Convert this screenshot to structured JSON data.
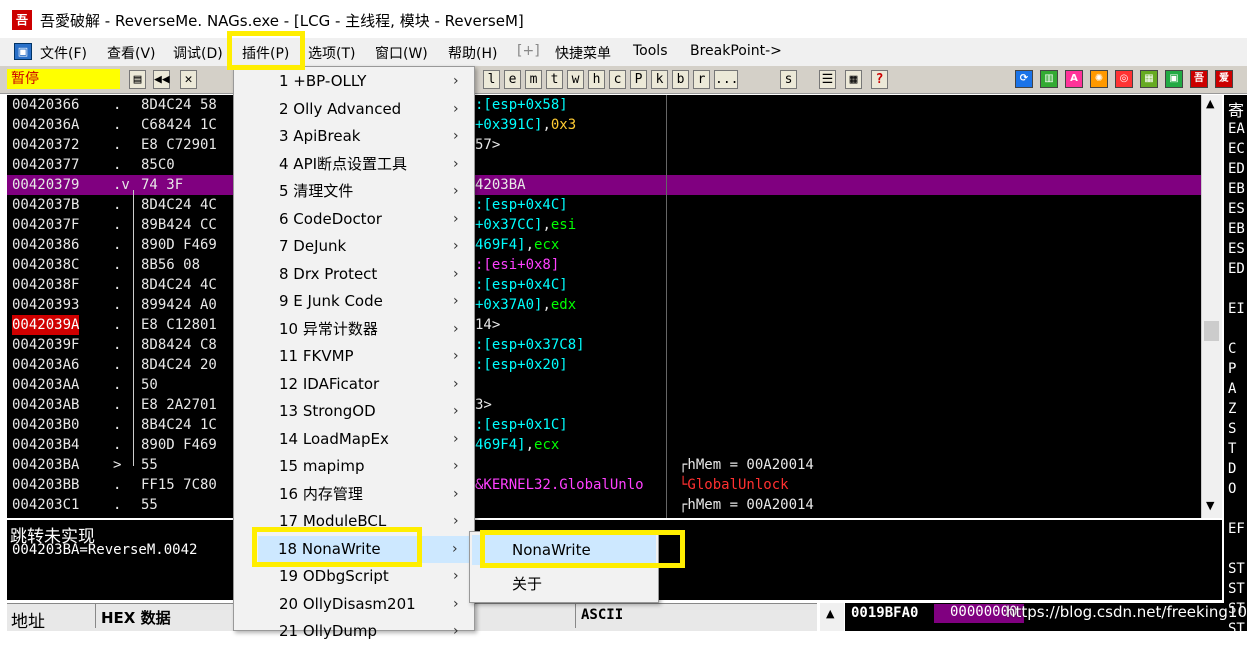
{
  "window": {
    "title": "吾愛破解 - ReverseMe. NAGs.exe - [LCG -  主线程, 模块 - ReverseM]",
    "icon": "吾"
  },
  "menubar": {
    "items": [
      "文件(F)",
      "查看(V)",
      "调试(D)",
      "插件(P)",
      "选项(T)",
      "窗口(W)",
      "帮助(H)",
      "[+]",
      "快捷菜单",
      "Tools",
      "BreakPoint->"
    ]
  },
  "toolbar": {
    "status": "暂停",
    "letters": [
      "l",
      "e",
      "m",
      "t",
      "w",
      "h",
      "c",
      "P",
      "k",
      "b",
      "r",
      "...",
      "s"
    ],
    "right_icons": [
      "吾",
      "爱"
    ]
  },
  "disasm": {
    "rows": [
      {
        "addr": "00420366",
        "mark": ".",
        "hex": "8D4C24 58",
        "asm": [
          [
            "c",
            ":[esp+0x58]"
          ]
        ],
        "cmt": ""
      },
      {
        "addr": "0042036A",
        "mark": ".",
        "hex": "C68424 1C",
        "asm": [
          [
            "c",
            "+0x391C]"
          ],
          [
            "w",
            ","
          ],
          [
            "y",
            "0x3"
          ]
        ],
        "cmt": ""
      },
      {
        "addr": "00420372",
        "mark": ".",
        "hex": "E8 C72901",
        "asm": [
          [
            "w",
            "57>"
          ]
        ],
        "cmt": ""
      },
      {
        "addr": "00420377",
        "mark": ".",
        "hex": "85C0",
        "asm": [],
        "cmt": ""
      },
      {
        "addr": "00420379",
        "mark": ".v",
        "hex": "74 3F",
        "asm": [
          [
            "w",
            "4203BA"
          ]
        ],
        "cmt": "",
        "hl": true
      },
      {
        "addr": "0042037B",
        "mark": ".",
        "hex": "8D4C24 4C",
        "asm": [
          [
            "c",
            ":[esp+0x4C]"
          ]
        ],
        "cmt": ""
      },
      {
        "addr": "0042037F",
        "mark": ".",
        "hex": "89B424 CC",
        "asm": [
          [
            "c",
            "+0x37CC]"
          ],
          [
            "w",
            ","
          ],
          [
            "g",
            "esi"
          ]
        ],
        "cmt": ""
      },
      {
        "addr": "00420386",
        "mark": ".",
        "hex": "890D F469",
        "asm": [
          [
            "c",
            "469F4]"
          ],
          [
            "w",
            ","
          ],
          [
            "g",
            "ecx"
          ]
        ],
        "cmt": ""
      },
      {
        "addr": "0042038C",
        "mark": ".",
        "hex": "8B56 08",
        "asm": [
          [
            "m",
            ":[esi+0x8]"
          ]
        ],
        "cmt": ""
      },
      {
        "addr": "0042038F",
        "mark": ".",
        "hex": "8D4C24 4C",
        "asm": [
          [
            "c",
            ":[esp+0x4C]"
          ]
        ],
        "cmt": ""
      },
      {
        "addr": "00420393",
        "mark": ".",
        "hex": "899424 A0",
        "asm": [
          [
            "c",
            "+0x37A0]"
          ],
          [
            "w",
            ","
          ],
          [
            "g",
            "edx"
          ]
        ],
        "cmt": ""
      },
      {
        "addr": "0042039A",
        "mark": ".",
        "hex": "E8 C12801",
        "asm": [
          [
            "w",
            "14>"
          ]
        ],
        "cmt": "",
        "red": true
      },
      {
        "addr": "0042039F",
        "mark": ".",
        "hex": "8D8424 C8",
        "asm": [
          [
            "c",
            ":[esp+0x37C8]"
          ]
        ],
        "cmt": ""
      },
      {
        "addr": "004203A6",
        "mark": ".",
        "hex": "8D4C24 20",
        "asm": [
          [
            "c",
            ":[esp+0x20]"
          ]
        ],
        "cmt": ""
      },
      {
        "addr": "004203AA",
        "mark": ".",
        "hex": "50",
        "asm": [],
        "cmt": ""
      },
      {
        "addr": "004203AB",
        "mark": ".",
        "hex": "E8 2A2701",
        "asm": [
          [
            "w",
            "3>"
          ]
        ],
        "cmt": ""
      },
      {
        "addr": "004203B0",
        "mark": ".",
        "hex": "8B4C24 1C",
        "asm": [
          [
            "c",
            ":[esp+0x1C]"
          ]
        ],
        "cmt": ""
      },
      {
        "addr": "004203B4",
        "mark": ".",
        "hex": "890D F469",
        "asm": [
          [
            "c",
            "469F4]"
          ],
          [
            "w",
            ","
          ],
          [
            "g",
            "ecx"
          ]
        ],
        "cmt": ""
      },
      {
        "addr": "004203BA",
        "mark": ">",
        "hex": "55",
        "asm": [],
        "cmt": "┌hMem = 00A20014"
      },
      {
        "addr": "004203BB",
        "mark": ".",
        "hex": "FF15 7C80",
        "asm": [
          [
            "m",
            "&KERNEL32.GlobalUnlo"
          ]
        ],
        "cmt": "└GlobalUnlock",
        "cmtred": true
      },
      {
        "addr": "004203C1",
        "mark": ".",
        "hex": "55",
        "asm": [],
        "cmt": "┌hMem = 00A20014"
      }
    ]
  },
  "info": {
    "line1": "跳转未实现",
    "line2": "004203BA=ReverseM.0042"
  },
  "registers": {
    "header": "寄",
    "labels": [
      "EA",
      "EC",
      "ED",
      "EB",
      "ES",
      "EB",
      "ES",
      "ED",
      "",
      "EI",
      "",
      "C",
      "P",
      "A",
      "Z",
      "S",
      "T",
      "D",
      "O",
      "",
      "EF",
      "",
      "ST",
      "ST",
      "ST",
      "ST"
    ]
  },
  "dump": {
    "col_addr": "地址",
    "col_hex": "HEX 数据",
    "col_ascii": "ASCII"
  },
  "stack": {
    "addr": "0019BFA0",
    "value": "00000000"
  },
  "watermark": "https://blog.csdn.net/freeking101",
  "plugin_menu": {
    "items": [
      {
        "label": "1 +BP-OLLY"
      },
      {
        "label": "2 Olly Advanced"
      },
      {
        "label": "3 ApiBreak"
      },
      {
        "label": "4 API断点设置工具"
      },
      {
        "label": "5 清理文件"
      },
      {
        "label": "6 CodeDoctor"
      },
      {
        "label": "7 DeJunk"
      },
      {
        "label": "8 Drx Protect"
      },
      {
        "label": "9 E Junk Code"
      },
      {
        "label": "10 异常计数器"
      },
      {
        "label": "11 FKVMP"
      },
      {
        "label": "12 IDAFicator"
      },
      {
        "label": "13 StrongOD"
      },
      {
        "label": "14 LoadMapEx"
      },
      {
        "label": "15 mapimp"
      },
      {
        "label": "16 内存管理"
      },
      {
        "label": "17 ModuleBCL"
      },
      {
        "label": "18 NonaWrite"
      },
      {
        "label": "19 ODbgScript"
      },
      {
        "label": "20 OllyDisasm201"
      },
      {
        "label": "21 OllyDump"
      }
    ]
  },
  "nona_submenu": {
    "items": [
      "NonaWrite",
      "关于"
    ]
  }
}
